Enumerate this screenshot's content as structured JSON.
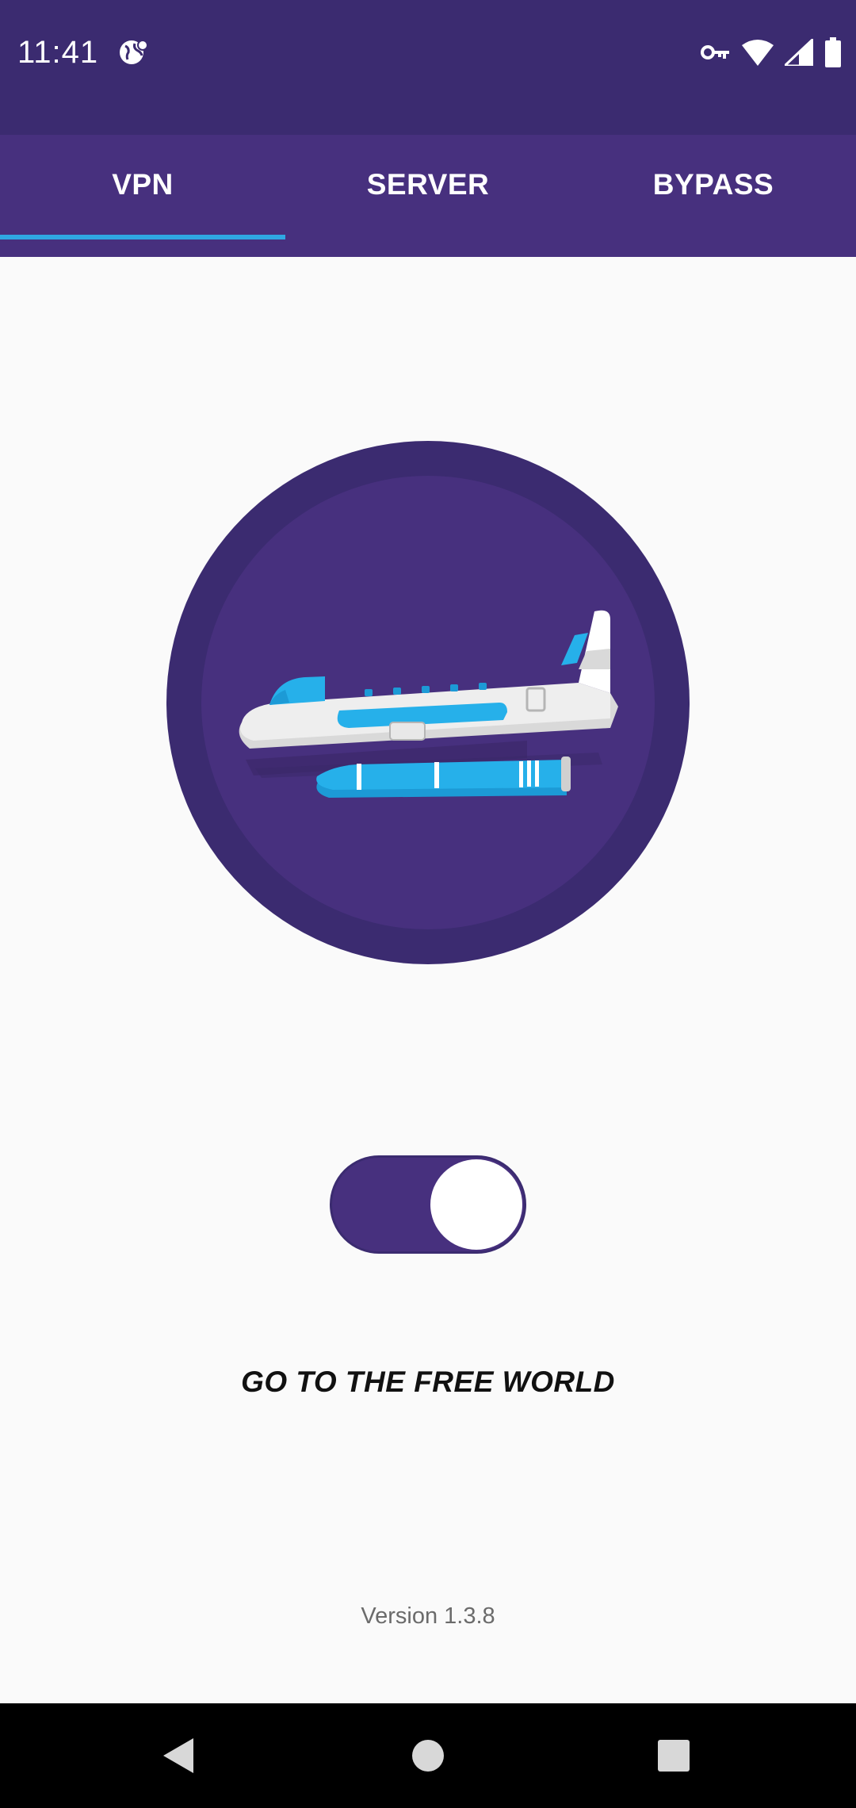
{
  "status_bar": {
    "time": "11:41",
    "icons": [
      "vpn-globe-icon",
      "vpn-key-icon",
      "wifi-icon",
      "signal-icon",
      "battery-icon"
    ]
  },
  "tabs": [
    {
      "label": "VPN",
      "selected": true
    },
    {
      "label": "SERVER",
      "selected": false
    },
    {
      "label": "BYPASS",
      "selected": false
    }
  ],
  "main": {
    "hero_icon": "airplane-icon",
    "toggle_on": true,
    "cta_text": "GO TO THE FREE WORLD",
    "version_text": "Version 1.3.8"
  },
  "nav_bar": {
    "icons": [
      "back-icon",
      "home-icon",
      "recents-icon"
    ]
  },
  "colors": {
    "status_bar": "#3b2b70",
    "tab_bar": "#47307e",
    "tab_indicator": "#2fa7e2",
    "circle_outer": "#3b2b70",
    "circle_inner": "#47307e",
    "accent_blue": "#1fa6e4"
  }
}
